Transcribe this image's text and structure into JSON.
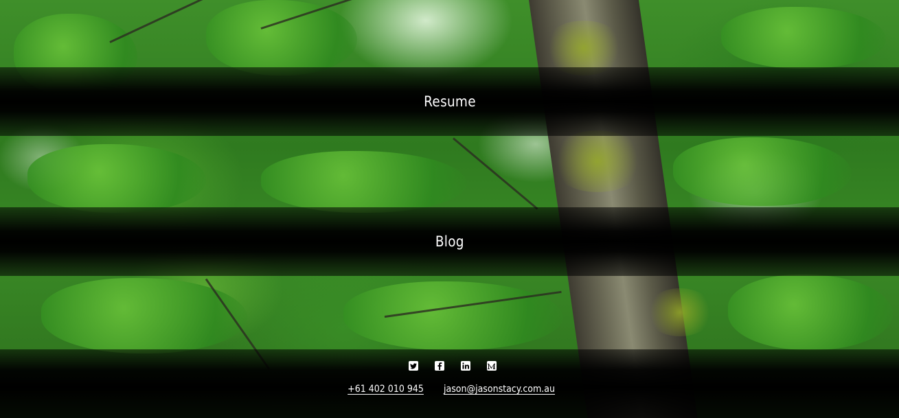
{
  "nav": {
    "items": [
      {
        "label": "Resume"
      },
      {
        "label": "Blog"
      }
    ]
  },
  "footer": {
    "social": [
      {
        "icon": "twitter-icon"
      },
      {
        "icon": "facebook-icon"
      },
      {
        "icon": "linkedin-icon"
      },
      {
        "icon": "medium-icon"
      }
    ],
    "phone": "+61 402 010 945",
    "email": "jason@jasonstacy.com.au"
  },
  "colors": {
    "band": "#000000",
    "text": "#ffffff",
    "foliage": "#3f8f2a"
  }
}
